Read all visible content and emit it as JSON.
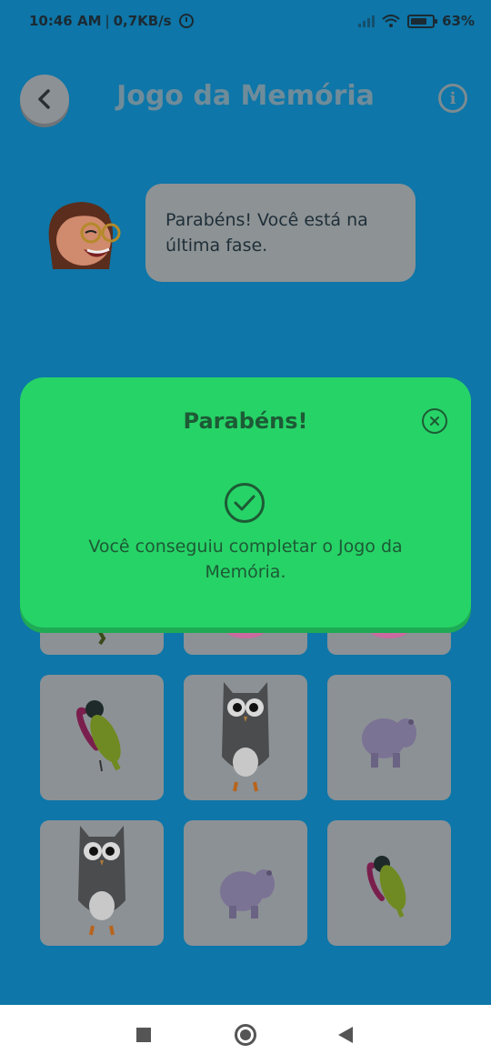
{
  "status_bar": {
    "time": "10:46 AM",
    "separator": "|",
    "network_speed": "0,7KB/s",
    "battery": "63%"
  },
  "header": {
    "title": "Jogo da Memória",
    "back_icon": "chevron-left-icon",
    "info_icon": "info-icon"
  },
  "speech_bubble": {
    "text": "Parabéns! Você está na última fase."
  },
  "cards": {
    "row1": [
      "toucan",
      "cake",
      "cake"
    ],
    "row2": [
      "toucan",
      "owl",
      "hippo"
    ],
    "row3": [
      "owl",
      "hippo",
      "toucan"
    ]
  },
  "modal": {
    "title": "Parabéns!",
    "message": "Você conseguiu completar o Jogo da Memória.",
    "close_icon": "close-circle-icon",
    "check_icon": "check-circle-icon"
  },
  "colors": {
    "background": "#0e76a8",
    "modal": "#26d367",
    "modal_text": "#1d5a35"
  }
}
